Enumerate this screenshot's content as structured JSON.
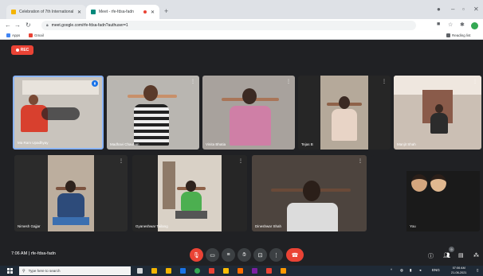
{
  "browser": {
    "tabs": [
      {
        "title": "Celebration of 7th International",
        "active": false,
        "favicon_color": "#f4b400"
      },
      {
        "title": "Meet - rfe-fdsa-fadn",
        "active": true,
        "favicon_color": "#00897b"
      }
    ],
    "address": "meet.google.com/rfe-fdsa-fadn?authuser=1",
    "bookmarks": [
      {
        "label": "Apps",
        "color": "#4285f4"
      },
      {
        "label": "Gmail",
        "color": "#ea4335"
      }
    ],
    "reading_list": "Reading list"
  },
  "meet": {
    "rec_label": "REC",
    "meeting_time": "7:06 AM",
    "meeting_code": "rfe-fdsa-fadn",
    "participants": [
      {
        "name": "Ma Ram Upadhyay"
      },
      {
        "name": "Madhavi Chauhan"
      },
      {
        "name": "Vinita Bhatia"
      },
      {
        "name": "Tejas B"
      },
      {
        "name": "Manjit Shah"
      },
      {
        "name": "Nimesh Gajjar"
      },
      {
        "name": "Gyaneshwar Tailang"
      },
      {
        "name": "Dineshwar Shah"
      },
      {
        "name": "You"
      }
    ],
    "participant_count_badge": "9"
  },
  "taskbar": {
    "search_placeholder": "Type here to search",
    "time": "07:06 AM",
    "date": "21-06-2021",
    "lang": "ENG"
  }
}
